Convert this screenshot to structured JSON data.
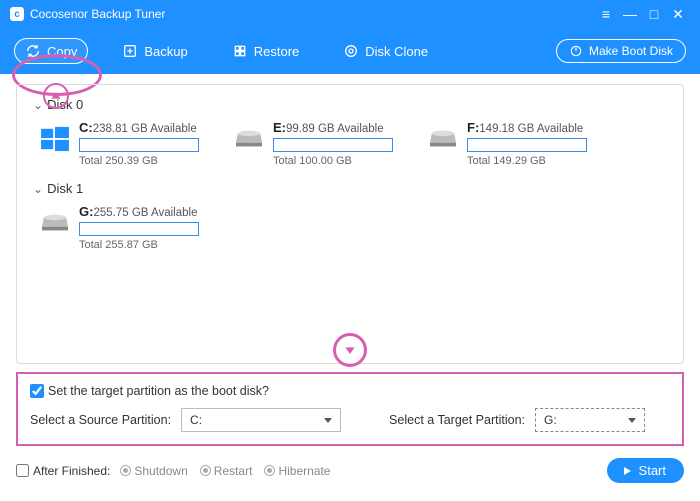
{
  "app": {
    "title": "Cocosenor Backup Tuner"
  },
  "toolbar": {
    "copy": "Copy",
    "backup": "Backup",
    "restore": "Restore",
    "clone": "Disk Clone",
    "boot": "Make Boot Disk"
  },
  "disks": {
    "d0": {
      "label": "Disk 0"
    },
    "d1": {
      "label": "Disk 1"
    }
  },
  "part_c": {
    "letter": "C:",
    "avail": "238.81 GB Available",
    "total": "Total 250.39 GB"
  },
  "part_e": {
    "letter": "E:",
    "avail": "99.89 GB Available",
    "total": "Total 100.00 GB"
  },
  "part_f": {
    "letter": "F:",
    "avail": "149.18 GB Available",
    "total": "Total 149.29 GB"
  },
  "part_g": {
    "letter": "G:",
    "avail": "255.75 GB Available",
    "total": "Total 255.87 GB"
  },
  "opts": {
    "boot_question": "Set the target partition as the boot disk?",
    "source_label": "Select a Source Partition:",
    "source_value": "C:",
    "target_label": "Select a Target Partition:",
    "target_value": "G:"
  },
  "footer": {
    "after_label": "After Finished:",
    "shutdown": "Shutdown",
    "restart": "Restart",
    "hibernate": "Hibernate",
    "start": "Start"
  }
}
